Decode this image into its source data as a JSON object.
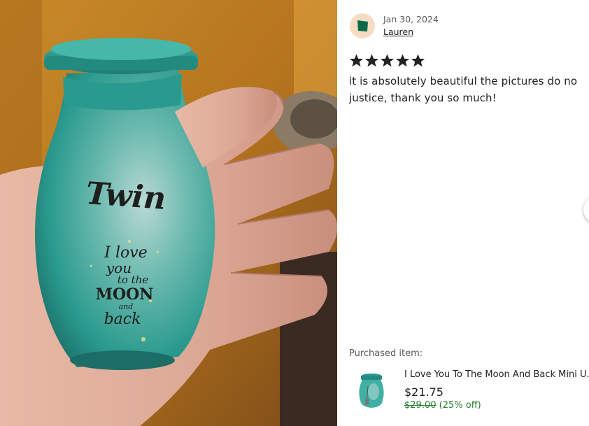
{
  "review": {
    "date": "Jan 30, 2024",
    "reviewer": "Lauren",
    "rating": 5,
    "rating_max": 5,
    "text": "it is absolutely beautiful the pictures do no justice, thank you so much!"
  },
  "photo": {
    "urn_name": "Twin",
    "urn_words": [
      "I love",
      "you",
      "to the",
      "MOON",
      "and",
      "back"
    ]
  },
  "purchase": {
    "label": "Purchased item:",
    "item_title": "I Love You To The Moon And Back Mini U...",
    "price": "$21.75",
    "original_price": "$29.00",
    "discount": "(25% off)"
  },
  "colors": {
    "star": "#222222",
    "sale_green": "#257e2d",
    "avatar_bg": "#f6dcc3",
    "avatar_icon": "#0a6b4a",
    "urn_teal": "#2a9a8e"
  },
  "icons": {
    "avatar": "pentagon-logo-icon",
    "star": "star-icon",
    "nav": "next-arrow-icon"
  }
}
